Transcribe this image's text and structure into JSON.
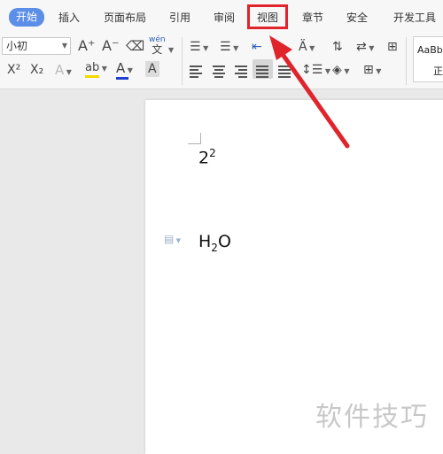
{
  "tabs": [
    "开始",
    "插入",
    "页面布局",
    "引用",
    "审阅",
    "视图",
    "章节",
    "安全",
    "开发工具"
  ],
  "active_tab": "开始",
  "highlighted_tab": "视图",
  "font": {
    "size_value": "小初"
  },
  "toolbar": {
    "grow_font": "A⁺",
    "shrink_font": "A⁻",
    "pinyin_top": "wén",
    "pinyin_bottom": "文",
    "superscript": "X²",
    "subscript": "X₂",
    "text_effect": "A",
    "highlight_letters": "ab",
    "font_color_letter": "A",
    "char_shade_letter": "A"
  },
  "styles": {
    "preview": "AaBbC",
    "name": "正"
  },
  "document": {
    "line1_base": "2",
    "line1_sup": "2",
    "line2_h": "H",
    "line2_sub": "2",
    "line2_o": "O"
  },
  "watermark": "软件技巧",
  "colors": {
    "accent": "#5b8ee6",
    "annotation_red": "#e0242c",
    "highlight_yellow": "#f5d800",
    "font_color_blue": "#1f3fd0"
  }
}
